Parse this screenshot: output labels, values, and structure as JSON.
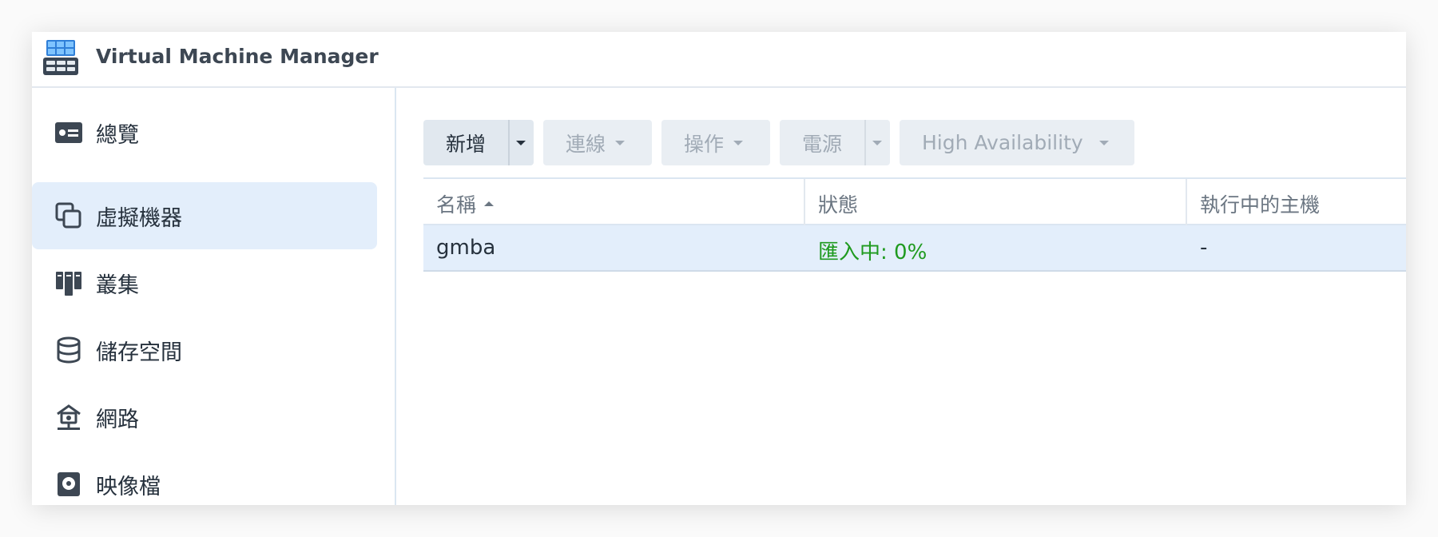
{
  "app": {
    "title": "Virtual Machine Manager",
    "icon": "virtual-machine-manager-icon"
  },
  "sidebar": {
    "items": [
      {
        "label": "總覽",
        "icon": "overview-card-icon",
        "active": false
      },
      {
        "label": "虛擬機器",
        "icon": "virtual-machine-icon",
        "active": true
      },
      {
        "label": "叢集",
        "icon": "cluster-icon",
        "active": false
      },
      {
        "label": "儲存空間",
        "icon": "storage-database-icon",
        "active": false
      },
      {
        "label": "網路",
        "icon": "network-icon",
        "active": false
      },
      {
        "label": "映像檔",
        "icon": "image-disc-icon",
        "active": false
      }
    ]
  },
  "toolbar": {
    "create_label": "新增",
    "connect_label": "連線",
    "action_label": "操作",
    "power_label": "電源",
    "ha_label": "High Availability"
  },
  "table": {
    "columns": [
      "名稱",
      "狀態",
      "執行中的主機"
    ],
    "sort_column": "名稱",
    "sort_direction": "ascending",
    "rows": [
      {
        "name": "gmba",
        "status": "匯入中: 0%",
        "host": "-"
      }
    ]
  },
  "colors": {
    "accent_active": "#e3eefb",
    "status_importing": "#1f9a1f",
    "button_bg": "#e1e8ef"
  }
}
